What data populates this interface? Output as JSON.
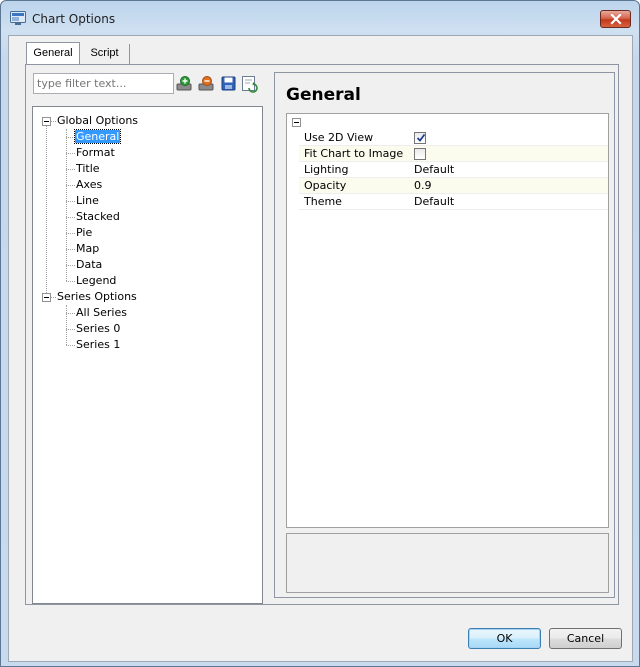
{
  "window": {
    "title": "Chart Options"
  },
  "tabs": [
    {
      "label": "General",
      "active": true
    },
    {
      "label": "Script",
      "active": false
    }
  ],
  "filter": {
    "placeholder": "type filter text..."
  },
  "toolbar_icons": [
    "add-option-icon",
    "remove-option-icon",
    "save-icon",
    "refresh-icon"
  ],
  "tree": {
    "groups": [
      {
        "label": "Global Options",
        "items": [
          "General",
          "Format",
          "Title",
          "Axes",
          "Line",
          "Stacked",
          "Pie",
          "Map",
          "Data",
          "Legend"
        ],
        "selected": "General"
      },
      {
        "label": "Series Options",
        "items": [
          "All Series",
          "Series 0",
          "Series 1"
        ]
      }
    ]
  },
  "panel": {
    "title": "General",
    "properties": [
      {
        "name": "Use 2D View",
        "type": "checkbox",
        "checked": true
      },
      {
        "name": "Fit Chart to Image",
        "type": "checkbox",
        "checked": false
      },
      {
        "name": "Lighting",
        "type": "text",
        "value": "Default"
      },
      {
        "name": "Opacity",
        "type": "text",
        "value": "0.9"
      },
      {
        "name": "Theme",
        "type": "text",
        "value": "Default"
      }
    ]
  },
  "buttons": {
    "ok": "OK",
    "cancel": "Cancel"
  },
  "colors": {
    "selection": "#3399ff",
    "close_button": "#c3391e",
    "alt_row": "#fbfbee"
  }
}
